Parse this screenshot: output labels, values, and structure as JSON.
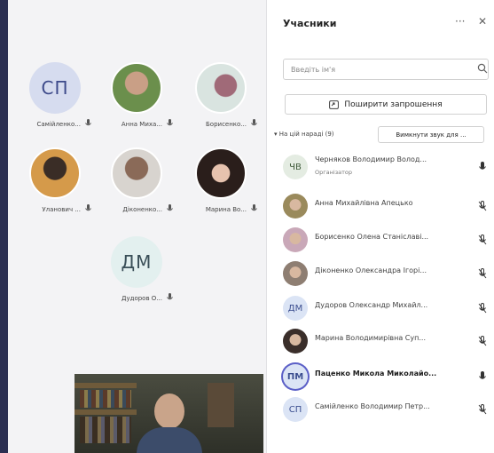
{
  "stage": {
    "tiles": [
      {
        "initials": "СП",
        "name": "Самійленко...",
        "kind": "initials"
      },
      {
        "initials": "",
        "name": "Анна Миха...",
        "kind": "photo",
        "color": "#9a8a5c"
      },
      {
        "initials": "",
        "name": "Борисенко... ",
        "kind": "photo",
        "color": "#b8c8c0"
      },
      {
        "initials": "",
        "name": "Уланович ...",
        "kind": "photo",
        "color": "#c28a4a"
      },
      {
        "initials": "",
        "name": "Діконенко...",
        "kind": "photo",
        "color": "#8e7e72"
      },
      {
        "initials": "",
        "name": "Марина Во...",
        "kind": "photo",
        "color": "#4a3a34"
      },
      {
        "initials": "ДМ",
        "name": "Дудоров О...",
        "kind": "initials-light"
      }
    ]
  },
  "panel": {
    "title": "Учасники",
    "more_label": "···",
    "close_label": "✕",
    "search_placeholder": "Введіть ім'я",
    "share_label": "Поширити запрошення",
    "section_label": "▾ На цій нараді (9)",
    "mute_all_label": "Вимкнути звук для ...",
    "participants": [
      {
        "initials": "ЧВ",
        "name": "Черняков Володимир Волод...",
        "role": "Організатор",
        "bold": false,
        "avatar": "initials"
      },
      {
        "initials": "",
        "name": "Анна Михайлівна Апецько",
        "role": "",
        "bold": false,
        "avatar": "photo",
        "color": "#9a8a5c"
      },
      {
        "initials": "",
        "name": "Борисенко Олена Станіславі...",
        "role": "",
        "bold": false,
        "avatar": "photo",
        "color": "#c9a8b8"
      },
      {
        "initials": "",
        "name": "Діконенко Олександра Ігорі...",
        "role": "",
        "bold": false,
        "avatar": "photo",
        "color": "#8e7e72"
      },
      {
        "initials": "ДМ",
        "name": "Дудоров Олександр Михайл...",
        "role": "",
        "bold": false,
        "avatar": "initials"
      },
      {
        "initials": "",
        "name": "Марина Володимирівна Суп...",
        "role": "",
        "bold": false,
        "avatar": "photo",
        "color": "#3a2e2a"
      },
      {
        "initials": "ПМ",
        "name": "Паценко Микола Миколайо...",
        "role": "",
        "bold": true,
        "avatar": "initials-ring"
      },
      {
        "initials": "СП",
        "name": "Самійленко Володимир Петр...",
        "role": "",
        "bold": false,
        "avatar": "initials"
      }
    ]
  }
}
